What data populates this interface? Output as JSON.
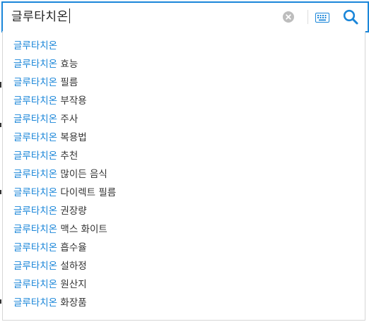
{
  "search": {
    "query": "글루타치온",
    "clear_icon": "clear-circle-icon",
    "keyboard_icon": "keyboard-icon",
    "search_icon": "magnifier-icon",
    "accent_color": "#1a86d9"
  },
  "suggestions": [
    {
      "keyword": "글루타치온",
      "rest": ""
    },
    {
      "keyword": "글루타치온",
      "rest": "효능"
    },
    {
      "keyword": "글루타치온",
      "rest": "필름"
    },
    {
      "keyword": "글루타치온",
      "rest": "부작용"
    },
    {
      "keyword": "글루타치온",
      "rest": "주사"
    },
    {
      "keyword": "글루타치온",
      "rest": "복용법"
    },
    {
      "keyword": "글루타치온",
      "rest": "추천"
    },
    {
      "keyword": "글루타치온",
      "rest": "많이든 음식"
    },
    {
      "keyword": "글루타치온",
      "rest": "다이렉트 필름"
    },
    {
      "keyword": "글루타치온",
      "rest": "권장량"
    },
    {
      "keyword": "글루타치온",
      "rest": "맥스 화이트"
    },
    {
      "keyword": "글루타치온",
      "rest": "흡수율"
    },
    {
      "keyword": "글루타치온",
      "rest": "설하정"
    },
    {
      "keyword": "글루타치온",
      "rest": "원산지"
    },
    {
      "keyword": "글루타치온",
      "rest": "화장품"
    }
  ]
}
